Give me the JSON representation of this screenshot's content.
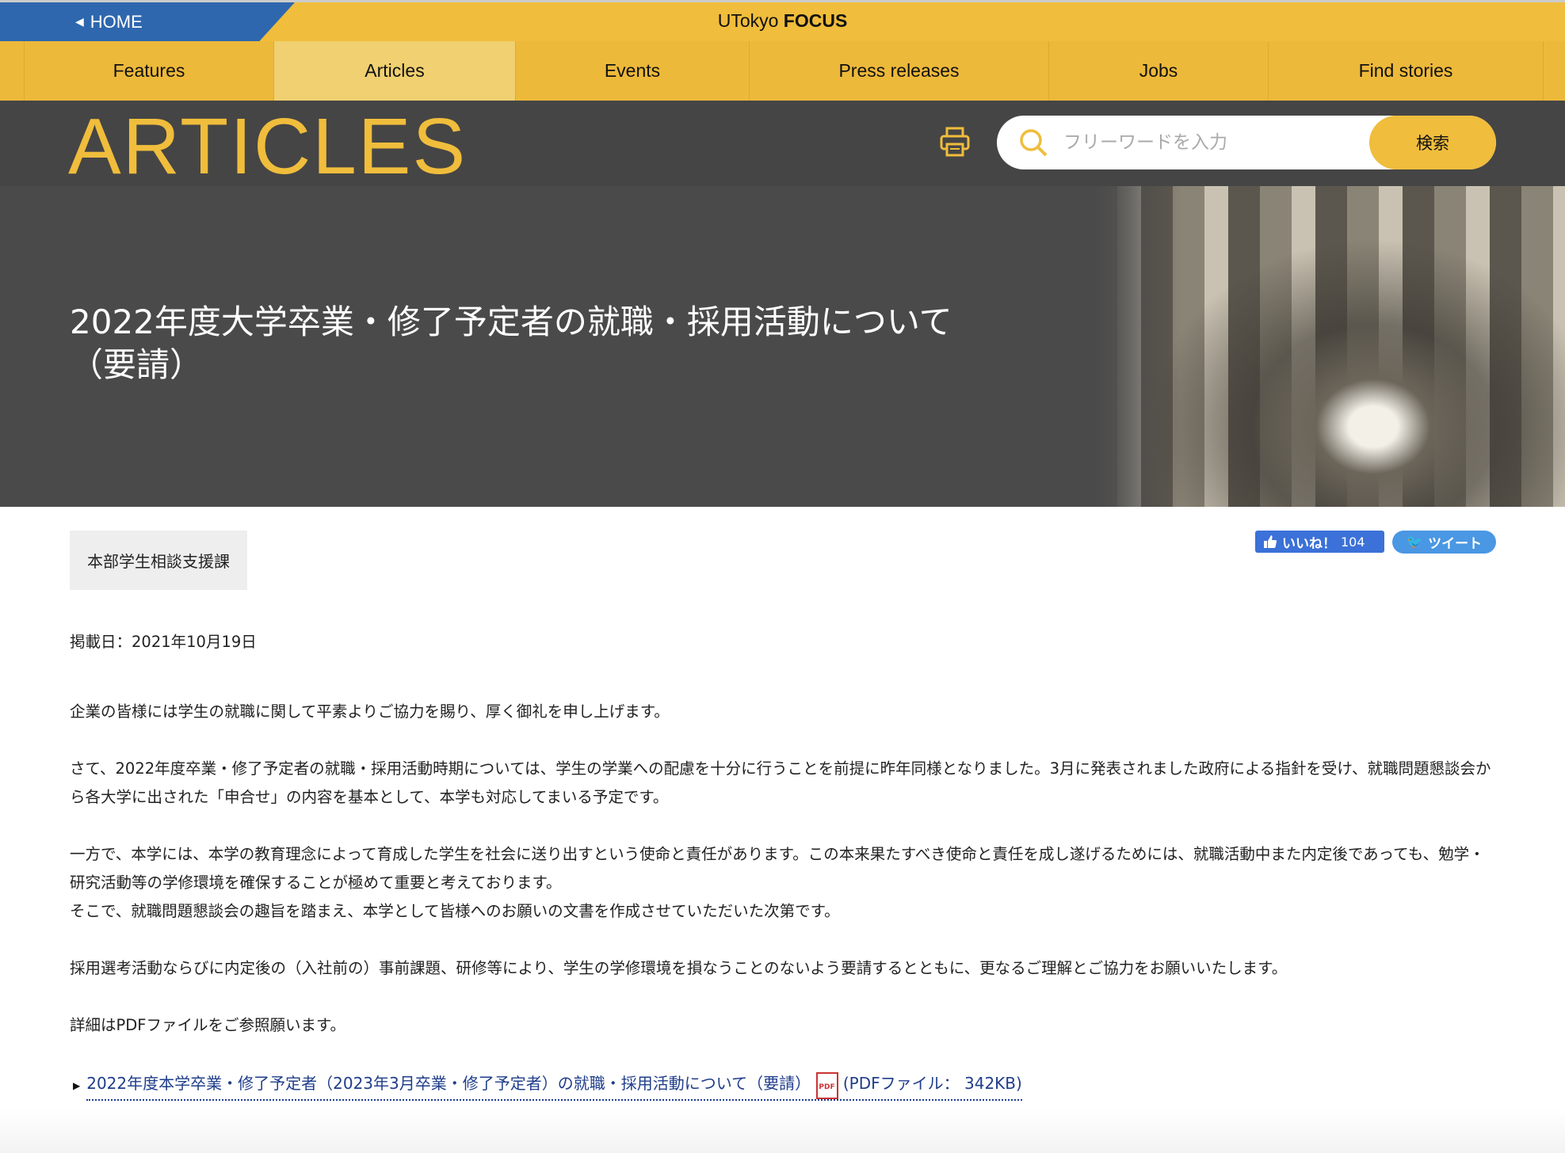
{
  "topbar": {
    "home": "HOME",
    "brand_light": "UTokyo",
    "brand_bold": "FOCUS"
  },
  "nav": [
    {
      "label": "Features"
    },
    {
      "label": "Articles",
      "active": true
    },
    {
      "label": "Events"
    },
    {
      "label": "Press releases"
    },
    {
      "label": "Jobs"
    },
    {
      "label": "Find stories"
    }
  ],
  "header": {
    "section": "ARTICLES",
    "search_placeholder": "フリーワードを入力",
    "search_button": "検索",
    "accent": "#f0bd3c"
  },
  "hero": {
    "title": "2022年度大学卒業・修了予定者の就職・採用活動について（要請）"
  },
  "article": {
    "department": "本部学生相談支援課",
    "like_label": "いいね！",
    "like_count": "104",
    "tweet_label": "ツイート",
    "date": "掲載日：2021年10月19日",
    "paragraphs": [
      "企業の皆様には学生の就職に関して平素よりご協力を賜り、厚く御礼を申し上げます。",
      "さて、2022年度卒業・修了予定者の就職・採用活動時期については、学生の学業への配慮を十分に行うことを前提に昨年同様となりました。3月に発表されました政府による指針を受け、就職問題懇談会から各大学に出された「申合せ」の内容を基本として、本学も対応してまいる予定です。",
      "一方で、本学には、本学の教育理念によって育成した学生を社会に送り出すという使命と責任があります。この本来果たすべき使命と責任を成し遂げるためには、就職活動中また内定後であっても、勉学・研究活動等の学修環境を確保することが極めて重要と考えております。\nそこで、就職問題懇談会の趣旨を踏まえ、本学として皆様へのお願いの文書を作成させていただいた次第です。",
      "採用選考活動ならびに内定後の（入社前の）事前課題、研修等により、学生の学修環境を損なうことのないよう要請するとともに、更なるご理解とご協力をお願いいたします。",
      "詳細はPDFファイルをご参照願います。"
    ],
    "link_text": "2022年度本学卒業・修了予定者（2023年3月卒業・修了予定者）の就職・採用活動について（要請）",
    "pdf_badge": "PDF",
    "link_size": "(PDFファイル： 342KB)"
  }
}
